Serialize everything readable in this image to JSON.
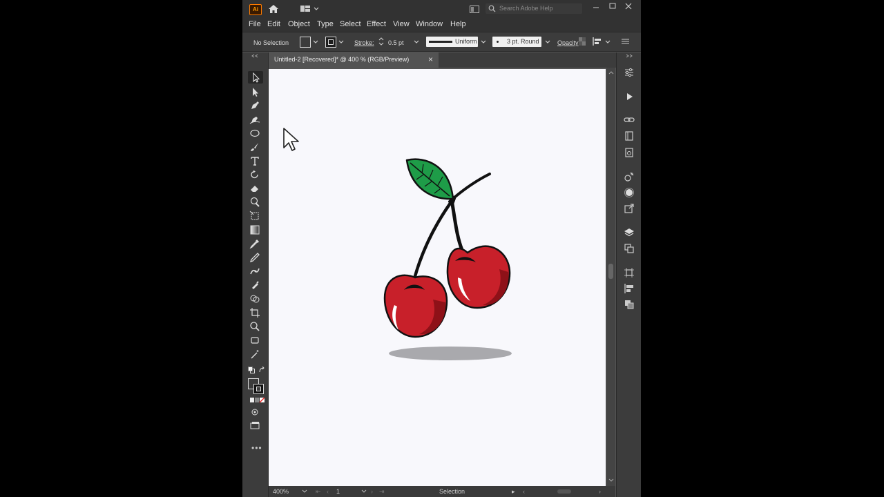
{
  "app": {
    "logo": "Ai",
    "search_placeholder": "Search Adobe Help",
    "menu": [
      "File",
      "Edit",
      "Object",
      "Type",
      "Select",
      "Effect",
      "View",
      "Window",
      "Help"
    ]
  },
  "control_bar": {
    "selection": "No Selection",
    "stroke_label": "Stroke:",
    "stroke_weight": "0.5 pt",
    "profile": "Uniform",
    "brush": "3 pt. Round",
    "opacity_label": "Opacity"
  },
  "document": {
    "tab_title": "Untitled-2 [Recovered]* @ 400 % (RGB/Preview)",
    "close_glyph": "×"
  },
  "status": {
    "zoom": "400%",
    "artboard_number": "1",
    "tool_name": "Selection"
  },
  "colors": {
    "cherry_red": "#c8202a",
    "leaf_green": "#1e9c48",
    "shadow_gray": "#a9a9ad"
  }
}
